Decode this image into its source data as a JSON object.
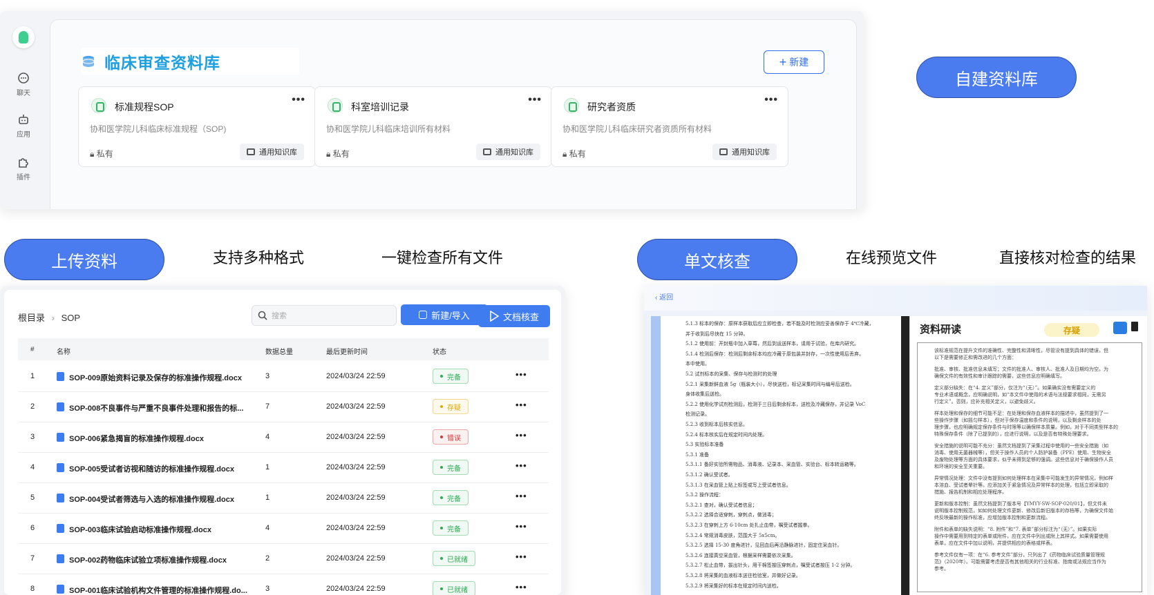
{
  "top": {
    "sidebar": [
      {
        "label": "聊天",
        "icon": "chat-icon"
      },
      {
        "label": "应用",
        "icon": "robot-icon"
      },
      {
        "label": "插件",
        "icon": "puzzle-icon"
      }
    ],
    "title": "临床审查资料库",
    "new_button": "新建",
    "cards": [
      {
        "title": "标准规程SOP",
        "desc": "协和医学院儿科临床标准规程（SOP)",
        "privacy": "私有",
        "tag": "通用知识库"
      },
      {
        "title": "科室培训记录",
        "desc": "协和医学院儿科临床培训所有材料",
        "privacy": "私有",
        "tag": "通用知识库"
      },
      {
        "title": "研究者资质",
        "desc": "协和医学院儿科临床研究者资质所有材料",
        "privacy": "私有",
        "tag": "通用知识库"
      }
    ]
  },
  "labels": {
    "self_build": "自建资料库",
    "upload": "上传资料",
    "multi_format": "支持多种格式",
    "one_click": "一键检查所有文件",
    "single_check": "单文核查",
    "online_preview": "在线预览文件",
    "direct_verify": "直接核对检查的结果"
  },
  "files": {
    "breadcrumb_root": "根目录",
    "breadcrumb_sep": "›",
    "breadcrumb_current": "SOP",
    "search_placeholder": "搜索",
    "new_import": "新建/导入",
    "doc_check": "文档核查",
    "columns": [
      "#",
      "名称",
      "数据总量",
      "最后更新时间",
      "状态"
    ],
    "rows": [
      {
        "no": "1",
        "name": "SOP-009原始资料记录及保存的标准操作规程.docx",
        "count": "3",
        "time": "2024/03/24 22:59",
        "status": "完备",
        "status_color": "#2eaa55"
      },
      {
        "no": "2",
        "name": "SOP-008不良事件与严重不良事件处理和报告的标...",
        "count": "7",
        "time": "2024/03/24 22:59",
        "status": "存疑",
        "status_color": "#e0a700"
      },
      {
        "no": "3",
        "name": "SOP-006紧急揭盲的标准操作规程.docx",
        "count": "4",
        "time": "2024/03/24 22:59",
        "status": "错误",
        "status_color": "#d93636"
      },
      {
        "no": "4",
        "name": "SOP-005受试者访视和随访的标准操作规程.docx",
        "count": "1",
        "time": "2024/03/24 22:59",
        "status": "完备",
        "status_color": "#2eaa55"
      },
      {
        "no": "5",
        "name": "SOP-004受试者筛选与入选的标准操作规程.docx",
        "count": "1",
        "time": "2024/03/24 22:59",
        "status": "完备",
        "status_color": "#2eaa55"
      },
      {
        "no": "6",
        "name": "SOP-003临床试验启动标准操作规程.docx",
        "count": "4",
        "time": "2024/03/24 22:59",
        "status": "完备",
        "status_color": "#2eaa55"
      },
      {
        "no": "7",
        "name": "SOP-002药物临床试验立项标准操作规程.docx",
        "count": "2",
        "time": "2024/03/24 22:59",
        "status": "已就绪",
        "status_color": "#2eaa55"
      },
      {
        "no": "8",
        "name": "SOP-001临床试验机构文件管理的标准操作规程.do...",
        "count": "3",
        "time": "2024/03/24 22:59",
        "status": "已就绪",
        "status_color": "#2eaa55"
      }
    ]
  },
  "preview": {
    "back": "‹ 返回",
    "panel_title": "资料研读",
    "status": "存疑",
    "doc_lines": [
      "5.1.3 标本的保存：原样本获取后应立即检查，若不能及时检测应妥善保存于 4℃冷藏，",
      "并于收到后尽快在 15 分钟。",
      "5.1.2 使用前：开封瓶中加入草莓，然后到运送样本，请用于试验，在库内研究。",
      "5.1.4 检测后保存：检测后剩余标本均应冷藏于原包装并封存，一次性使用后丢弃。",
      "本中使用。",
      "5.2 试剂标本的采集、保存与检测时的处理",
      "5.2.1 采集新鲜血液 5g（瓶装大小），尽快送检，标记采集时间与编号后送检。",
      "身体收集后送检。",
      "5.2.2 使用化学试剂检测后，检测于三日后剩余标本，送检及冷藏保存，并记录 VoC",
      "检测记录。",
      "5.2.3 收到标本后核实信息。",
      "5.2.4 标本核实后在规定时间内处理。",
      "5.3 实验标本准备",
      "5.3.1 准备",
      "5.3.1.1 备好实验所需物品、消毒液、记录本、采血管、实验台、标本转运箱等。",
      "5.3.1.2 确认受试者。",
      "5.3.1.3 在采血管上贴上标签或写上受试者信息。",
      "5.3.2 操作流程：",
      "5.3.2.1 查对，确认受试者信息；",
      "5.3.2.2 选择合适穿刺，穿刺点，做消毒；",
      "5.3.2.3 在穿刺上方 6-10cm 处扎止血带，嘱受试者握拳。",
      "5.3.2.4 常规消毒皮肤，范围大于 5x5cm。",
      "5.3.2.5 选择 15-30 度角进针，见回血后再沿静脉进针，固定住采血针。",
      "5.3.2.6 连接真空采血管，根据采样需要依次采集。",
      "5.3.2.7 松止血带，拔出针头，用干棉签按压穿刺点，嘱受试者按压 1-2 分钟。",
      "5.3.2.8 将采集的血液标本送往检验室，并做好记录。",
      "5.3.2.9 将采集好的标本在规定时间内送检。"
    ],
    "review_paras": [
      [
        "该标准规范在提升文件的准确性、完整性和清晰性，尽管没有提到具体的错误，但",
        "以下是需要修正和需改进的几个方面："
      ],
      [
        "批准、审核、批准信息未填写；文件的批准人、审核人、批准人及日期均为空。为",
        "确保文件的有效性和审计跟踪的需要，这些信息应明确填写。"
      ],
      [
        "定义部分缺失：在“4. 定义”部分，仅注为“（无）”。如果确实没有需要定义的",
        "专业术语或概念，应明确说明，如“本文件中使用的术语与法规要求相同，无需另",
        "行定义”。否则，应补充相关定义，以避免歧义。"
      ],
      [
        "样本处理和保存的细节可能不足：在处理和保存血液样本的描述中，虽然提到了一",
        "些操作步骤（如摇匀样本），但对于保存温度和条件的说明，以及剩余样本的处",
        "理步骤，也应明确规定保存条件与时限等以确保样本质量。例如，对于不同类型样本的",
        "特殊保存条件（除了已提到的），应进行说明，以及是否有特殊处理要求。"
      ],
      [
        "安全措施的说明可能不充分：虽然文档提到了采集过程中使用的一些安全措施（如",
        "消毒、使用无菌器械等），但关于操作人员的个人防护装备（PPE）使用、生物安全",
        "及废物处理等方面的具体要求，似乎未得到足够的强调。这些信息对于确保操作人员",
        "和环境的安全至关重要。"
      ],
      [
        "异常情况处理：文件中没有提到如何处理样本在采集中可能发生的异常情况，例如样",
        "本溶血、受试者晕针等。应添加关于紧急情况及异常样本的处理，包括立即采取的",
        "措施、报告机制和相应处理程序。"
      ],
      [
        "更新和版本控制：虽然文档提到了版本号【YMYY-SW-SOP-020/01】，但文件未",
        "说明版本控制规范，如如何处理文件更新、修改后新旧版本的存档等，为确保文件始",
        "终反映最新的操作标准，应增加版本控制和更新流程。"
      ],
      [
        "附件和表单的缺失说明：“8. 附件”和“7. 表单”部分标注为“（无）”。如果实际",
        "操作中需要用到特定的表单或附件，应在文件中列出或附上其样式。如果需要使用",
        "表单，应在文件中加以说明，并提供相应的表格或样表。"
      ],
      [
        "参考文件仅有一项：在“6. 参考文件”部分，只列出了《药物临床试验质量管理规",
        "范》（2020年）。可能需要考虑是否有其他相关的行业标准、指南或法规应当作为",
        "参考。"
      ]
    ]
  }
}
